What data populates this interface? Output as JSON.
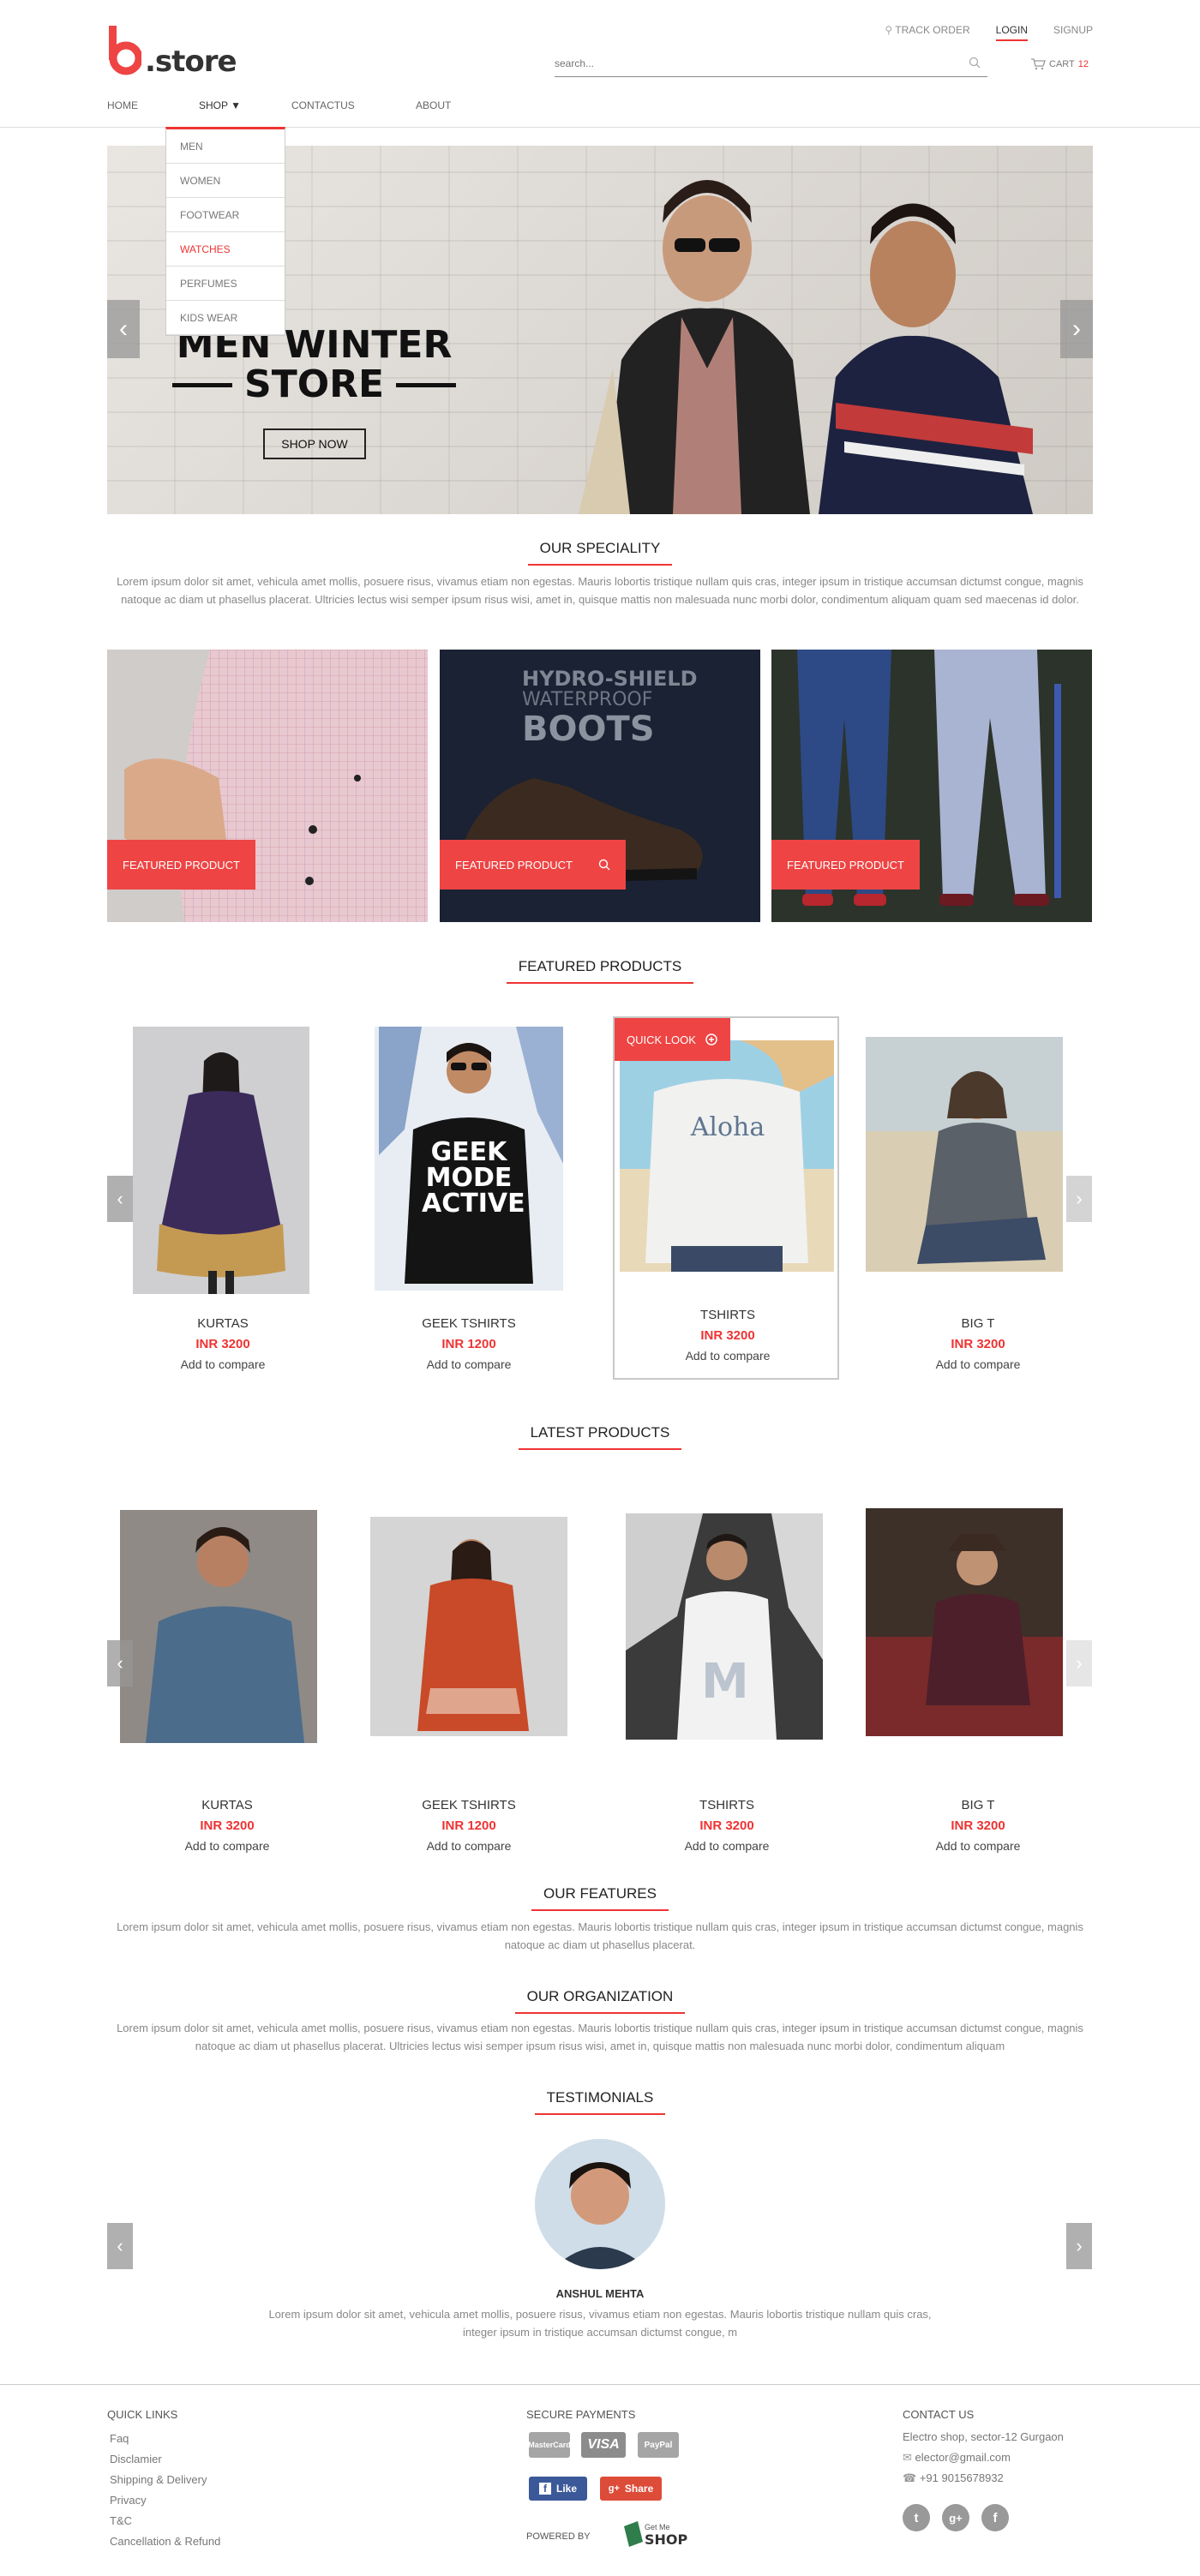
{
  "header": {
    "logo_mark": "b",
    "logo_text": ".store",
    "top_links": {
      "track": "TRACK ORDER",
      "login": "LOGIN",
      "signup": "SIGNUP"
    },
    "search_placeholder": "search...",
    "cart_label": "CART",
    "cart_count": "12"
  },
  "nav": {
    "home": "HOME",
    "shop": "SHOP",
    "contact": "CONTACTUS",
    "about": "ABOUT"
  },
  "shop_menu": [
    "MEN",
    "WOMEN",
    "FOOTWEAR",
    "WATCHES",
    "PERFUMES",
    "KIDS WEAR"
  ],
  "hero": {
    "line1": "MEN WINTER",
    "line2": "STORE",
    "button": "SHOP NOW"
  },
  "speciality": {
    "heading": "OUR SPECIALITY",
    "text": "Lorem ipsum dolor sit amet, vehicula amet mollis, posuere risus, vivamus etiam non egestas. Mauris lobortis tristique nullam quis cras, integer ipsum in tristique accumsan dictumst congue, magnis natoque ac diam ut phasellus placerat. Ultricies lectus wisi semper ipsum risus wisi, amet in, quisque mattis non malesuada nunc morbi dolor, condimentum aliquam quam sed maecenas id dolor.",
    "tiles": [
      {
        "badge": "FEATURED PRODUCT"
      },
      {
        "badge": "FEATURED PRODUCT",
        "overlay1": "HYDRO-SHIELD",
        "overlay2": "WATERPROOF",
        "overlay3": "BOOTS"
      },
      {
        "badge": "FEATURED PRODUCT"
      }
    ]
  },
  "featured": {
    "heading": "FEATURED PRODUCTS",
    "quick_look": "QUICK LOOK",
    "items": [
      {
        "name": "KURTAS",
        "price": "INR 3200",
        "compare": "Add to compare"
      },
      {
        "name": "GEEK TSHIRTS",
        "price": "INR 1200",
        "compare": "Add to compare",
        "print": "GEEK MODE ACTIVE"
      },
      {
        "name": "TSHIRTS",
        "price": "INR 3200",
        "compare": "Add to compare",
        "print": "Aloha"
      },
      {
        "name": "BIG T",
        "price": "INR 3200",
        "compare": "Add to compare"
      }
    ]
  },
  "latest": {
    "heading": "LATEST PRODUCTS",
    "items": [
      {
        "name": "KURTAS",
        "price": "INR 3200",
        "compare": "Add to compare"
      },
      {
        "name": "GEEK TSHIRTS",
        "price": "INR 1200",
        "compare": "Add to compare"
      },
      {
        "name": "TSHIRTS",
        "price": "INR 3200",
        "compare": "Add to compare"
      },
      {
        "name": "BIG T",
        "price": "INR 3200",
        "compare": "Add to compare"
      }
    ]
  },
  "features": {
    "heading": "OUR FEATURES",
    "text": "Lorem ipsum dolor sit amet, vehicula amet mollis, posuere risus, vivamus etiam non egestas. Mauris lobortis tristique nullam quis cras, integer ipsum in tristique accumsan dictumst congue, magnis natoque ac diam ut phasellus placerat."
  },
  "organization": {
    "heading": "OUR ORGANIZATION",
    "text": "Lorem ipsum dolor sit amet, vehicula amet mollis, posuere risus, vivamus etiam non egestas. Mauris lobortis tristique nullam quis cras, integer ipsum in tristique accumsan dictumst congue, magnis natoque ac diam ut phasellus placerat. Ultricies lectus wisi semper ipsum risus wisi, amet in, quisque mattis non malesuada nunc morbi dolor, condimentum aliquam"
  },
  "testimonials": {
    "heading": "TESTIMONIALS",
    "name": "ANSHUL MEHTA",
    "text": "Lorem ipsum dolor sit amet, vehicula amet mollis, posuere risus, vivamus etiam non egestas. Mauris lobortis tristique nullam quis cras, integer ipsum in tristique accumsan dictumst congue, m"
  },
  "footer": {
    "quick_links_heading": "QUICK LINKS",
    "quick_links": [
      "Faq",
      "Disclamier",
      "Shipping & Delivery",
      "Privacy",
      "T&C",
      "Cancellation & Refund"
    ],
    "payments_heading": "SECURE PAYMENTS",
    "payments": [
      "MasterCard",
      "VISA",
      "PayPal"
    ],
    "fb_like": "Like",
    "gplus_share": "Share",
    "powered_by": "POWERED BY",
    "powered_logo_top": "Get Me",
    "powered_logo": "SHOP",
    "contact_heading": "CONTACT US",
    "address": "Electro shop, sector-12 Gurgaon",
    "email": "elector@gmail.com",
    "phone": "+91 9015678932",
    "social": [
      "twitter-icon",
      "google-plus-icon",
      "facebook-icon"
    ]
  },
  "colors": {
    "accent": "#ee4444",
    "text": "#555555",
    "muted": "#888888"
  }
}
